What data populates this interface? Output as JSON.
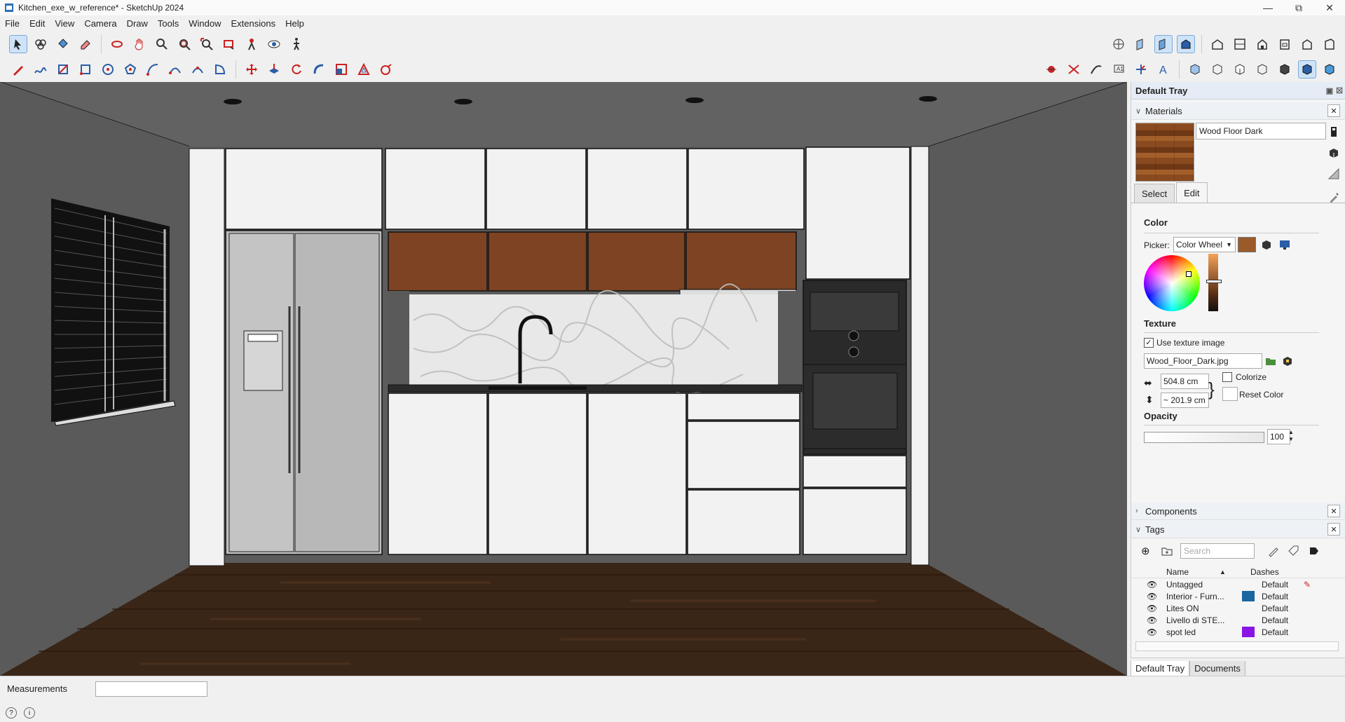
{
  "window": {
    "title": "Kitchen_exe_w_reference* - SketchUp 2024"
  },
  "menu": [
    "File",
    "Edit",
    "View",
    "Camera",
    "Draw",
    "Tools",
    "Window",
    "Extensions",
    "Help"
  ],
  "tray": {
    "title": "Default Tray",
    "materials": {
      "section_label": "Materials",
      "material_name": "Wood Floor Dark",
      "tab_select": "Select",
      "tab_edit": "Edit",
      "color_label": "Color",
      "picker_label": "Picker:",
      "picker_value": "Color Wheel",
      "accent_color": "#9b5a2a",
      "texture_label": "Texture",
      "use_texture_label": "Use texture image",
      "use_texture_checked": true,
      "texture_file": "Wood_Floor_Dark.jpg",
      "width": "504.8 cm",
      "height": "~ 201.9 cm",
      "colorize_label": "Colorize",
      "reset_color_label": "Reset Color",
      "opacity_label": "Opacity",
      "opacity_value": "100"
    },
    "components_label": "Components",
    "tags": {
      "section_label": "Tags",
      "search_placeholder": "Search",
      "col_name": "Name",
      "col_dashes": "Dashes",
      "rows": [
        {
          "name": "Untagged",
          "color": "",
          "dashes": "Default"
        },
        {
          "name": "Interior - Furn...",
          "color": "#1a66a0",
          "dashes": "Default"
        },
        {
          "name": "Lites ON",
          "color": "",
          "dashes": "Default"
        },
        {
          "name": "Livello di STE...",
          "color": "",
          "dashes": "Default"
        },
        {
          "name": "spot led",
          "color": "#8a14e6",
          "dashes": "Default"
        }
      ]
    },
    "bottom_tabs": [
      "Default Tray",
      "Documents"
    ]
  },
  "status": {
    "measurements_label": "Measurements",
    "measurements_value": ""
  }
}
